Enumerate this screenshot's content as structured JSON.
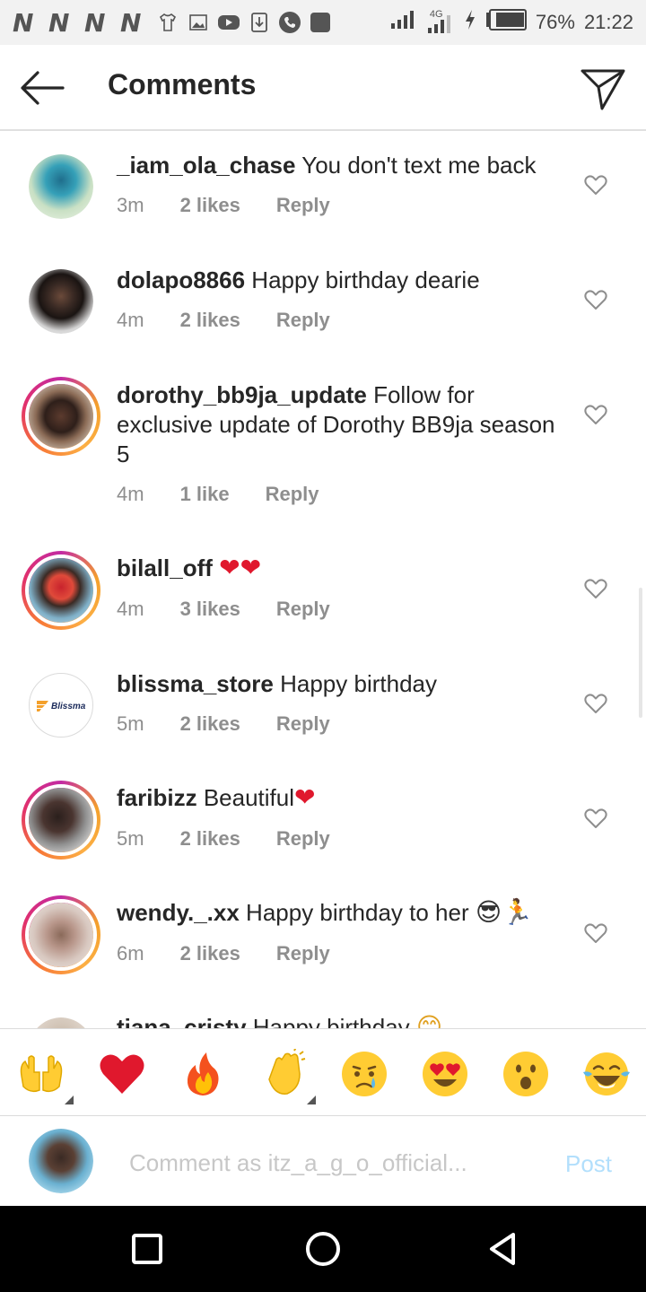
{
  "status_bar": {
    "left_letters": [
      "N",
      "N",
      "N",
      "N"
    ],
    "left_icons": [
      "tshirt-icon",
      "image-icon",
      "youtube-icon",
      "download-icon",
      "phone-icon",
      "square-app-icon"
    ],
    "network": "4G",
    "battery": "76%",
    "time": "21:22"
  },
  "header": {
    "title": "Comments",
    "back_icon": "arrow-left-icon",
    "send_icon": "direct-send-icon"
  },
  "comments": [
    {
      "username": "_iam_ola_chase",
      "text": "You don't text me back",
      "time": "3m",
      "likes": "2 likes",
      "reply": "Reply"
    },
    {
      "username": "dolapo8866",
      "text": "Happy birthday dearie",
      "time": "4m",
      "likes": "2 likes",
      "reply": "Reply"
    },
    {
      "username": "dorothy_bb9ja_update",
      "text": "Follow for exclusive update of Dorothy BB9ja season 5",
      "time": "4m",
      "likes": "1 like",
      "reply": "Reply"
    },
    {
      "username": "bilall_off",
      "text": "",
      "emoji": "❤❤",
      "time": "4m",
      "likes": "3 likes",
      "reply": "Reply"
    },
    {
      "username": "blissma_store",
      "text": "Happy birthday",
      "time": "5m",
      "likes": "2 likes",
      "reply": "Reply",
      "avatar_text": "Blissma"
    },
    {
      "username": "faribizz",
      "text": "Beautiful",
      "emoji": "❤",
      "time": "5m",
      "likes": "2 likes",
      "reply": "Reply"
    },
    {
      "username": "wendy._.xx",
      "text": "Happy birthday to her",
      "emoji": "😎🏃",
      "time": "6m",
      "likes": "2 likes",
      "reply": "Reply"
    },
    {
      "username": "tiana_cristy",
      "text": "Happy birthday",
      "emoji": "😊"
    }
  ],
  "quick_emojis": [
    {
      "name": "raising-hands-emoji-icon"
    },
    {
      "name": "red-heart-emoji-icon"
    },
    {
      "name": "fire-emoji-icon"
    },
    {
      "name": "clapping-hands-emoji-icon"
    },
    {
      "name": "crying-face-emoji-icon"
    },
    {
      "name": "heart-eyes-emoji-icon"
    },
    {
      "name": "astonished-face-emoji-icon"
    },
    {
      "name": "tears-of-joy-emoji-icon"
    }
  ],
  "composer": {
    "placeholder": "Comment as itz_a_g_o_official...",
    "post_label": "Post"
  },
  "colors": {
    "text": "#262626",
    "secondary": "#8e8e8e",
    "post_disabled": "#b2dffc",
    "heart": "#e0182d"
  }
}
